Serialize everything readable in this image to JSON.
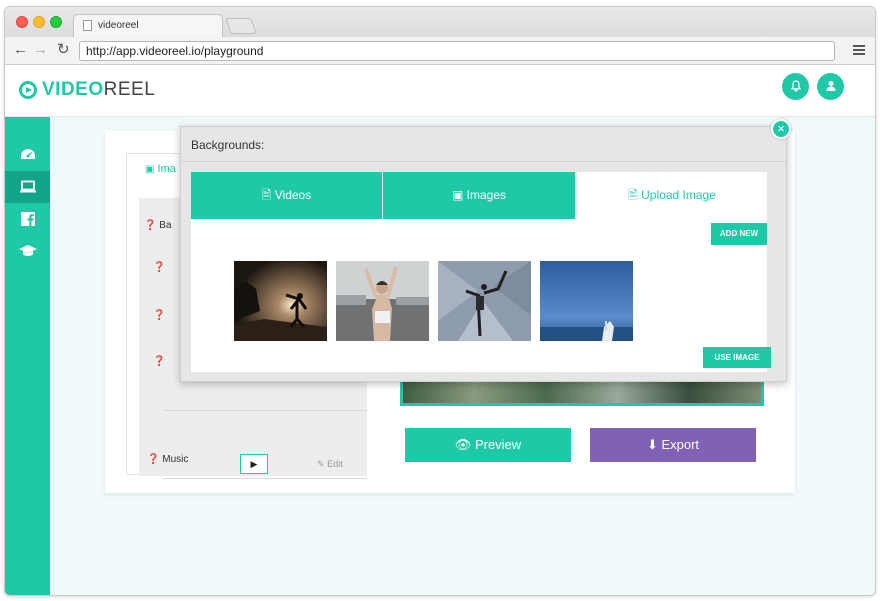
{
  "browser": {
    "tab_title": "videoreel",
    "url": "http://app.videoreel.io/playground"
  },
  "app": {
    "logo_part1": "VIDEO",
    "logo_part2": "REEL"
  },
  "sidebar": {
    "items": [
      {
        "icon": "dashboard-icon"
      },
      {
        "icon": "laptop-icon"
      },
      {
        "icon": "facebook-icon"
      },
      {
        "icon": "graduation-cap-icon"
      }
    ]
  },
  "left_panel": {
    "tab_label": "Ima",
    "row_label": "Ba",
    "music_label": "Music",
    "edit_label": "Edit"
  },
  "actions": {
    "preview_label": "Preview",
    "export_label": "Export"
  },
  "modal": {
    "title": "Backgrounds:",
    "tabs": [
      "Videos",
      "Images",
      "Upload Image"
    ],
    "active_tab": "Upload Image",
    "add_new_label": "ADD NEW",
    "use_image_label": "USE IMAGE",
    "close_symbol": "×"
  },
  "colors": {
    "accent": "#1fc9a8",
    "export": "#8061b5"
  }
}
